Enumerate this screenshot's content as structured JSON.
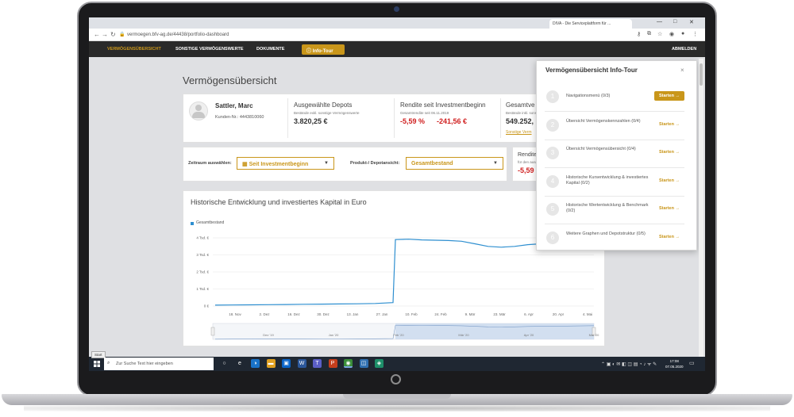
{
  "browser": {
    "tab_title": "DIVA - Die Serviceplattform für ...",
    "url": "vermoegen.bfv-ag.de/44438/portfolio-dashboard",
    "window_controls": [
      "—",
      "□",
      "✕"
    ]
  },
  "nav": {
    "items": [
      "VERMÖGENSÜBERSICHT",
      "SONSTIGE VERMÖGENSWERTE",
      "DOKUMENTE"
    ],
    "info_tour_label": "Info-Tour",
    "logout_label": "ABMELDEN"
  },
  "page": {
    "title": "Vermögensübersicht"
  },
  "customer": {
    "name": "Sattler, Marc",
    "number_label": "Kunden-Nr.: 4443810060"
  },
  "depots": {
    "label": "Ausgewählte Depots",
    "sublabel": "Bestände exkl. sonstige Vermögenswerte",
    "value": "3.820,25 €"
  },
  "rendite": {
    "label": "Rendite seit Investmentbeginn",
    "sublabel": "Gesamtrendite seit 06.11.2019",
    "percent": "-5,59 %",
    "amount": "-241,56 €"
  },
  "gesamt": {
    "label": "Gesamtve",
    "sublabel": "Bestände inkl. sonst",
    "value": "549.252,",
    "link": "Sonstige Verm"
  },
  "filters": {
    "period_label": "Zeitraum auswählen:",
    "period_value": "Seit Investmentbeginn",
    "product_label": "Produkt-/ Depotansicht:",
    "product_value": "Gesamtbestand"
  },
  "side_card": {
    "label": "Rendite",
    "sublabel": "für den ausgew",
    "value": "-5,59"
  },
  "chart_section": {
    "title": "Historische Entwicklung und investiertes Kapital in Euro"
  },
  "chart_data": {
    "type": "line",
    "series": [
      {
        "name": "Gesamtbestand",
        "x": [
          "11-12",
          "11-20",
          "11-28",
          "12-06",
          "12-14",
          "12-22",
          "12-30",
          "01-07",
          "01-15",
          "01-23",
          "01-28",
          "01-31",
          "02-04",
          "02-10",
          "02-17",
          "02-24",
          "03-02",
          "03-09",
          "03-16",
          "03-23",
          "03-30",
          "04-06",
          "04-13",
          "04-20",
          "04-27",
          "05-04",
          "05-07"
        ],
        "y": [
          50,
          60,
          70,
          80,
          90,
          100,
          110,
          120,
          130,
          150,
          200,
          3900,
          3920,
          3880,
          3860,
          3840,
          3800,
          3650,
          3500,
          3450,
          3500,
          3600,
          3650,
          3700,
          3720,
          3760,
          3820
        ]
      }
    ],
    "ytick_labels": [
      "0 €",
      "1 Tsd. €",
      "2 Tsd. €",
      "3 Tsd. €",
      "4 Tsd. €"
    ],
    "xtick_labels": [
      "18. Nov",
      "2. Dez",
      "16. Dez",
      "30. Dez",
      "13. Jan",
      "27. Jan",
      "10. Feb",
      "24. Feb",
      "9. Mär",
      "23. Mär",
      "6. Apr",
      "20. Apr",
      "4. Mai"
    ],
    "navigator_labels": [
      "Dez '19",
      "Jan '20",
      "Feb '20",
      "Mär '20",
      "Apr '20",
      "Mai '20"
    ],
    "ylim": [
      0,
      4000
    ],
    "grid": true,
    "legend": "top-left",
    "color": "#2e8fd0"
  },
  "info_tour": {
    "title": "Vermögensübersicht Info-Tour",
    "close": "×",
    "steps": [
      {
        "num": "1",
        "label": "Navigationsmenü (0/3)",
        "button": "Starten →"
      },
      {
        "num": "2",
        "label": "Übersicht Vermögenskennzahlen (0/4)",
        "button": "Starten →"
      },
      {
        "num": "3",
        "label": "Übersicht Vermögensübersicht (0/4)",
        "button": "Starten →"
      },
      {
        "num": "4",
        "label": "Historische Kursentwicklung & investiertes Kapital (0/2)",
        "button": "Starten →"
      },
      {
        "num": "5",
        "label": "Historische Wertentwicklung & Benchmark (0/2)",
        "button": "Starten →"
      },
      {
        "num": "6",
        "label": "Weitere Graphen und Depotstruktur (0/5)",
        "button": "Starten →"
      }
    ]
  },
  "taskbar": {
    "start_tooltip": "Start",
    "search_placeholder": "Zur Suche Text hier eingeben",
    "time": "17:08",
    "date": "07.05.2020"
  },
  "colors": {
    "accent": "#c9961a",
    "nav_bg": "#2a2a2a",
    "negative": "#d02020",
    "line": "#2e8fd0"
  }
}
